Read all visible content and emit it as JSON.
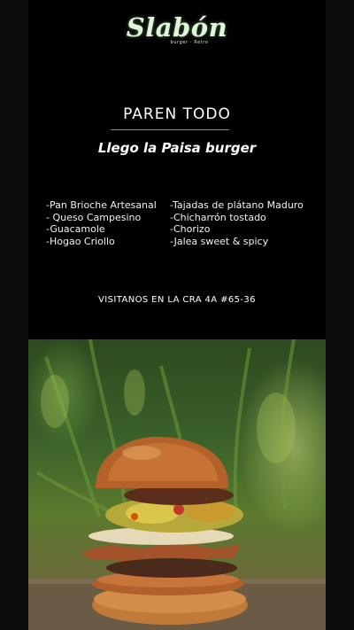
{
  "logo": {
    "name": "Slabón",
    "tagline": "burger · Retro"
  },
  "headline": "PAREN TODO",
  "subheadline": "Llego la Paisa burger",
  "ingredients": {
    "left": [
      "-Pan Brioche Artesanal",
      "- Queso Campesino",
      "-Guacamole",
      "-Hogao Criollo"
    ],
    "right": [
      "-Tajadas de plátano Maduro",
      "-Chicharrón tostado",
      "-Chorizo",
      "-Jalea sweet & spicy"
    ]
  },
  "address": "VISITANOS EN LA CRA 4A #65-36",
  "colors": {
    "background": "#000000",
    "logo": "#dff7d8",
    "text": "#ffffff"
  },
  "image": {
    "subject": "burger-photo"
  }
}
